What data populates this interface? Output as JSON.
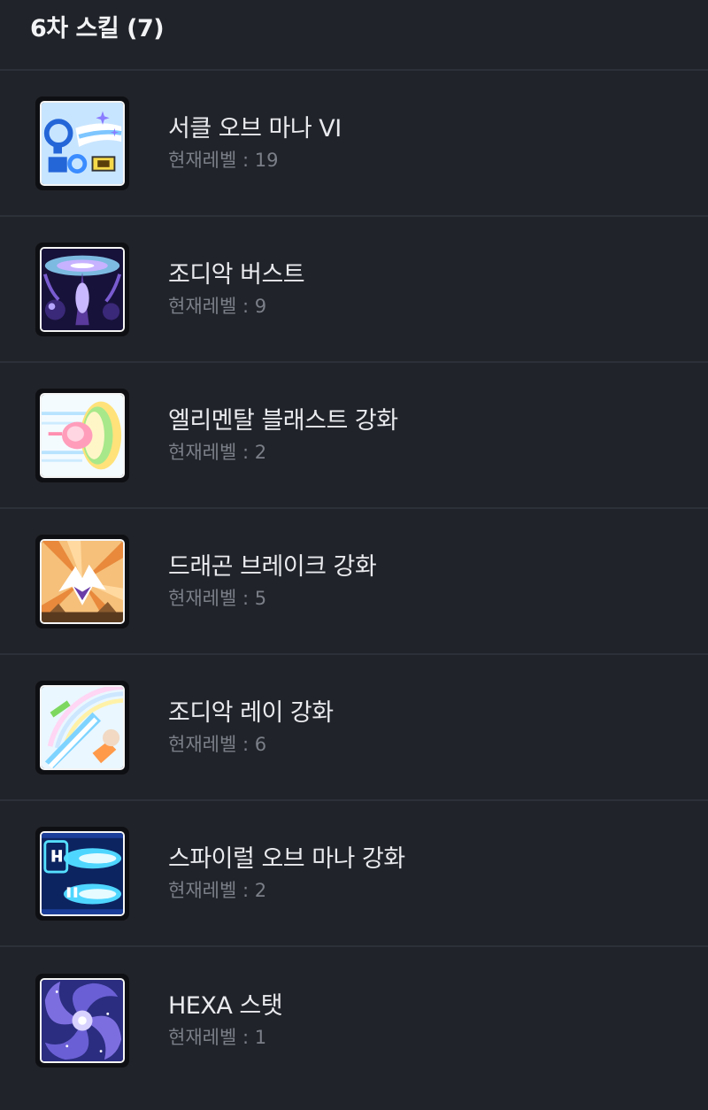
{
  "header": {
    "title": "6차 스킬 (7)"
  },
  "skills": [
    {
      "name": "서클 오브 마나 VI",
      "level": "현재레벨 : 19",
      "icon": "circle-of-mana-icon",
      "colors": [
        "#cfe9ff",
        "#2e6fd8",
        "#f5d84a"
      ]
    },
    {
      "name": "조디악 버스트",
      "level": "현재레벨 : 9",
      "icon": "zodiac-burst-icon",
      "colors": [
        "#1a1440",
        "#8e6ad8",
        "#7fd8ff"
      ]
    },
    {
      "name": "엘리멘탈 블래스트 강화",
      "level": "현재레벨 : 2",
      "icon": "elemental-blast-icon",
      "colors": [
        "#fff3c2",
        "#ff8fb0",
        "#9be07a"
      ]
    },
    {
      "name": "드래곤 브레이크 강화",
      "level": "현재레벨 : 5",
      "icon": "dragon-break-icon",
      "colors": [
        "#f0a35a",
        "#ffffff",
        "#6a3ca8"
      ]
    },
    {
      "name": "조디악 레이 강화",
      "level": "현재레벨 : 6",
      "icon": "zodiac-ray-icon",
      "colors": [
        "#e8f7ff",
        "#7fd4ff",
        "#ff9a4a"
      ]
    },
    {
      "name": "스파이럴 오브 마나 강화",
      "level": "현재레벨 : 2",
      "icon": "spiral-of-mana-icon",
      "colors": [
        "#0d2a6e",
        "#55e0ff",
        "#ffffff"
      ]
    },
    {
      "name": "HEXA 스탯",
      "level": "현재레벨 : 1",
      "icon": "hexa-stat-icon",
      "colors": [
        "#2a2a7a",
        "#9b8cf0",
        "#dcd6ff"
      ]
    }
  ]
}
